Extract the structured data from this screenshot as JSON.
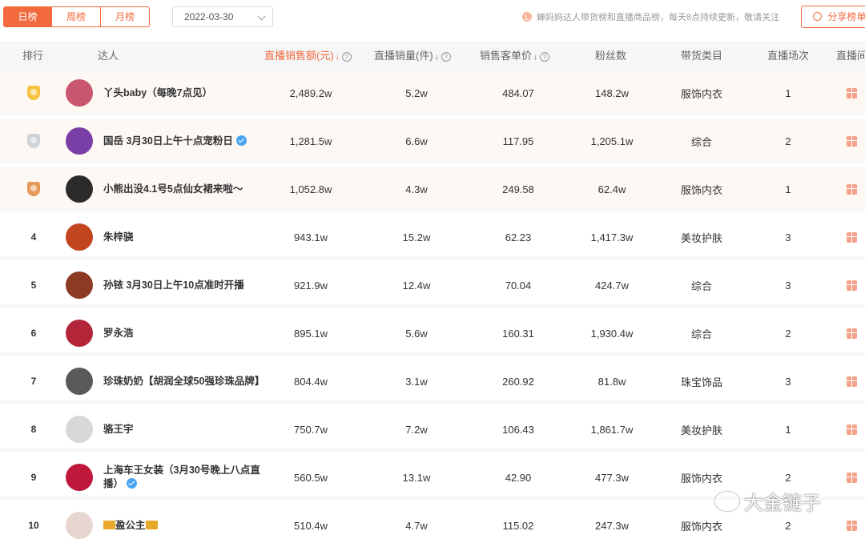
{
  "tabs": [
    {
      "label": "日榜",
      "active": true
    },
    {
      "label": "周榜",
      "active": false
    },
    {
      "label": "月榜",
      "active": false
    }
  ],
  "date": {
    "value": "2022-03-30",
    "icon": "chevron-down-icon"
  },
  "notice": {
    "text": "蝉妈妈达人带货榜和直播商品榜，每天8点持续更新，敬请关注",
    "icon": "info-icon"
  },
  "share": {
    "label": "分享榜单",
    "icon": "share-icon"
  },
  "accent_color": "#f26a3d",
  "columns": {
    "rank": "排行",
    "talent": "达人",
    "sales": "直播销售额(元)",
    "quantity": "直播销量(件)",
    "price": "销售客单价",
    "fans": "粉丝数",
    "category": "带货类目",
    "times": "直播场次",
    "extra": "直播间"
  },
  "rows": [
    {
      "rank": "1",
      "medal": "gold",
      "name": "丫头baby（每晚7点见）",
      "verified": false,
      "sales": "2,489.2w",
      "quantity": "5.2w",
      "price": "484.07",
      "fans": "148.2w",
      "category": "服饰内衣",
      "times": "1",
      "avatar_color": "#c9566f"
    },
    {
      "rank": "2",
      "medal": "silver",
      "name": "国岳 3月30日上午十点宠粉日",
      "verified": true,
      "sales": "1,281.5w",
      "quantity": "6.6w",
      "price": "117.95",
      "fans": "1,205.1w",
      "category": "综合",
      "times": "2",
      "avatar_color": "#7a3fa6"
    },
    {
      "rank": "3",
      "medal": "bronze",
      "name": "小熊出没4.1号5点仙女裙来啦～",
      "verified": false,
      "sales": "1,052.8w",
      "quantity": "4.3w",
      "price": "249.58",
      "fans": "62.4w",
      "category": "服饰内衣",
      "times": "1",
      "avatar_color": "#2b2b2b"
    },
    {
      "rank": "4",
      "medal": "",
      "name": "朱梓骁",
      "verified": false,
      "sales": "943.1w",
      "quantity": "15.2w",
      "price": "62.23",
      "fans": "1,417.3w",
      "category": "美妆护肤",
      "times": "3",
      "avatar_color": "#c2451f"
    },
    {
      "rank": "5",
      "medal": "",
      "name": "孙铱 3月30日上午10点准时开播",
      "verified": false,
      "sales": "921.9w",
      "quantity": "12.4w",
      "price": "70.04",
      "fans": "424.7w",
      "category": "综合",
      "times": "3",
      "avatar_color": "#8c3a22"
    },
    {
      "rank": "6",
      "medal": "",
      "name": "罗永浩",
      "verified": false,
      "sales": "895.1w",
      "quantity": "5.6w",
      "price": "160.31",
      "fans": "1,930.4w",
      "category": "综合",
      "times": "2",
      "avatar_color": "#b3263a"
    },
    {
      "rank": "7",
      "medal": "",
      "name": "珍珠奶奶【胡润全球50强珍珠品牌】",
      "verified": false,
      "sales": "804.4w",
      "quantity": "3.1w",
      "price": "260.92",
      "fans": "81.8w",
      "category": "珠宝饰品",
      "times": "3",
      "avatar_color": "#5a5a5a"
    },
    {
      "rank": "8",
      "medal": "",
      "name": "骆王宇",
      "verified": false,
      "sales": "750.7w",
      "quantity": "7.2w",
      "price": "106.43",
      "fans": "1,861.7w",
      "category": "美妆护肤",
      "times": "1",
      "avatar_color": "#d8d8d8"
    },
    {
      "rank": "9",
      "medal": "",
      "name": "上海车王女装（3月30号晚上八点直播）",
      "verified": true,
      "sales": "560.5w",
      "quantity": "13.1w",
      "price": "42.90",
      "fans": "477.3w",
      "category": "服饰内衣",
      "times": "2",
      "avatar_color": "#c0183c"
    },
    {
      "rank": "10",
      "medal": "",
      "name": "盈公主",
      "verified": false,
      "crowns": true,
      "sales": "510.4w",
      "quantity": "4.7w",
      "price": "115.02",
      "fans": "247.3w",
      "category": "服饰内衣",
      "times": "2",
      "avatar_color": "#e7d6cf"
    }
  ],
  "watermark": {
    "text": "大金链子",
    "icon": "wechat-icon"
  }
}
